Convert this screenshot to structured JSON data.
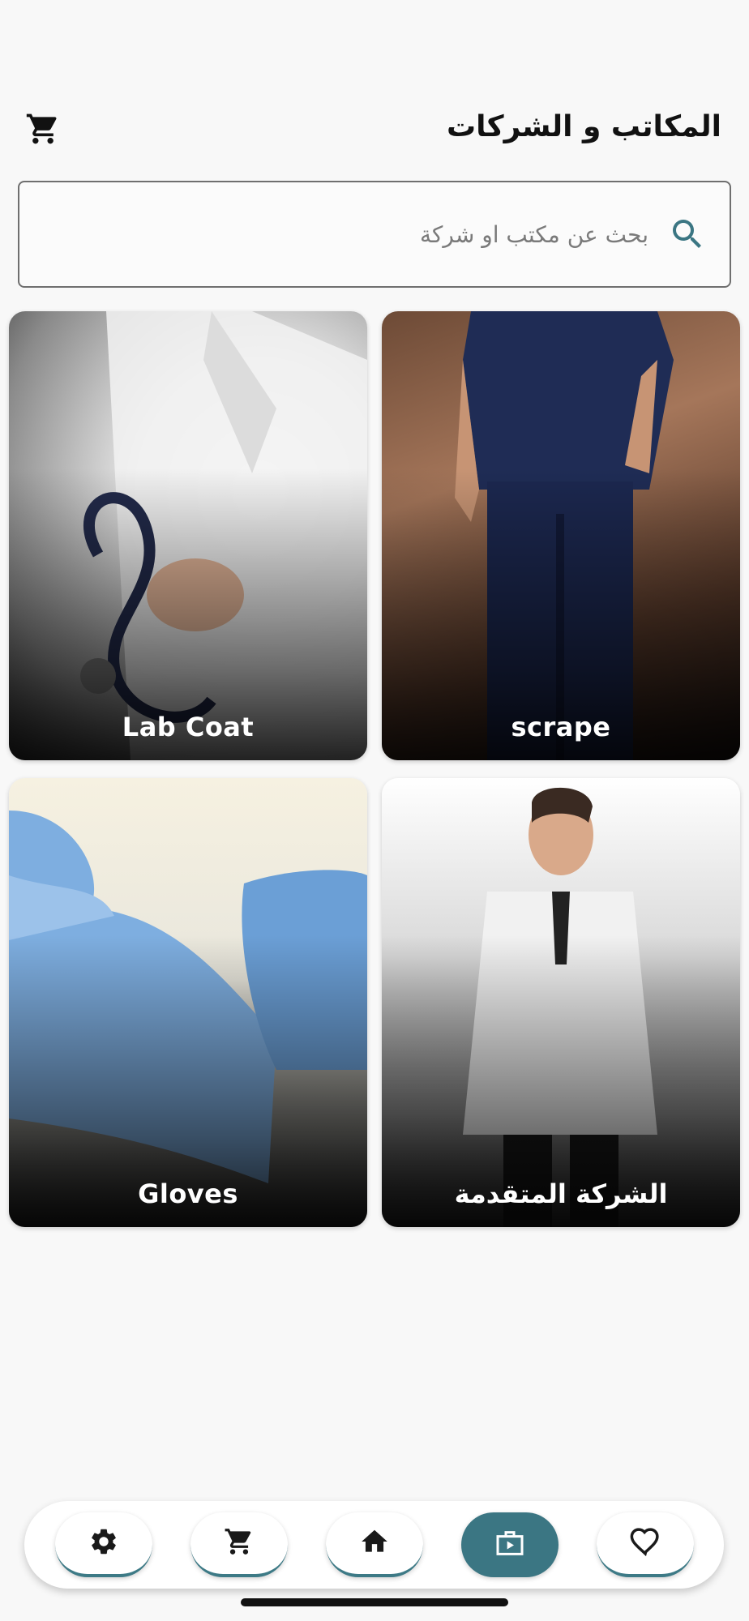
{
  "header": {
    "title": "المكاتب و الشركات",
    "cart_icon": "cart-icon"
  },
  "search": {
    "placeholder": "بحث عن مكتب او شركة",
    "value": "",
    "icon": "search-icon",
    "icon_color": "#3b7683"
  },
  "cards": [
    {
      "label": "Lab Coat"
    },
    {
      "label": "scrape"
    },
    {
      "label": "Gloves"
    },
    {
      "label": "الشركة المتقدمة"
    }
  ],
  "bottom_nav": {
    "items": [
      {
        "icon": "gear-icon",
        "active": false
      },
      {
        "icon": "cart-icon",
        "active": false
      },
      {
        "icon": "home-icon",
        "active": false
      },
      {
        "icon": "store-icon",
        "active": true
      },
      {
        "icon": "heart-icon",
        "active": false
      }
    ],
    "accent_color": "#3b7683"
  }
}
